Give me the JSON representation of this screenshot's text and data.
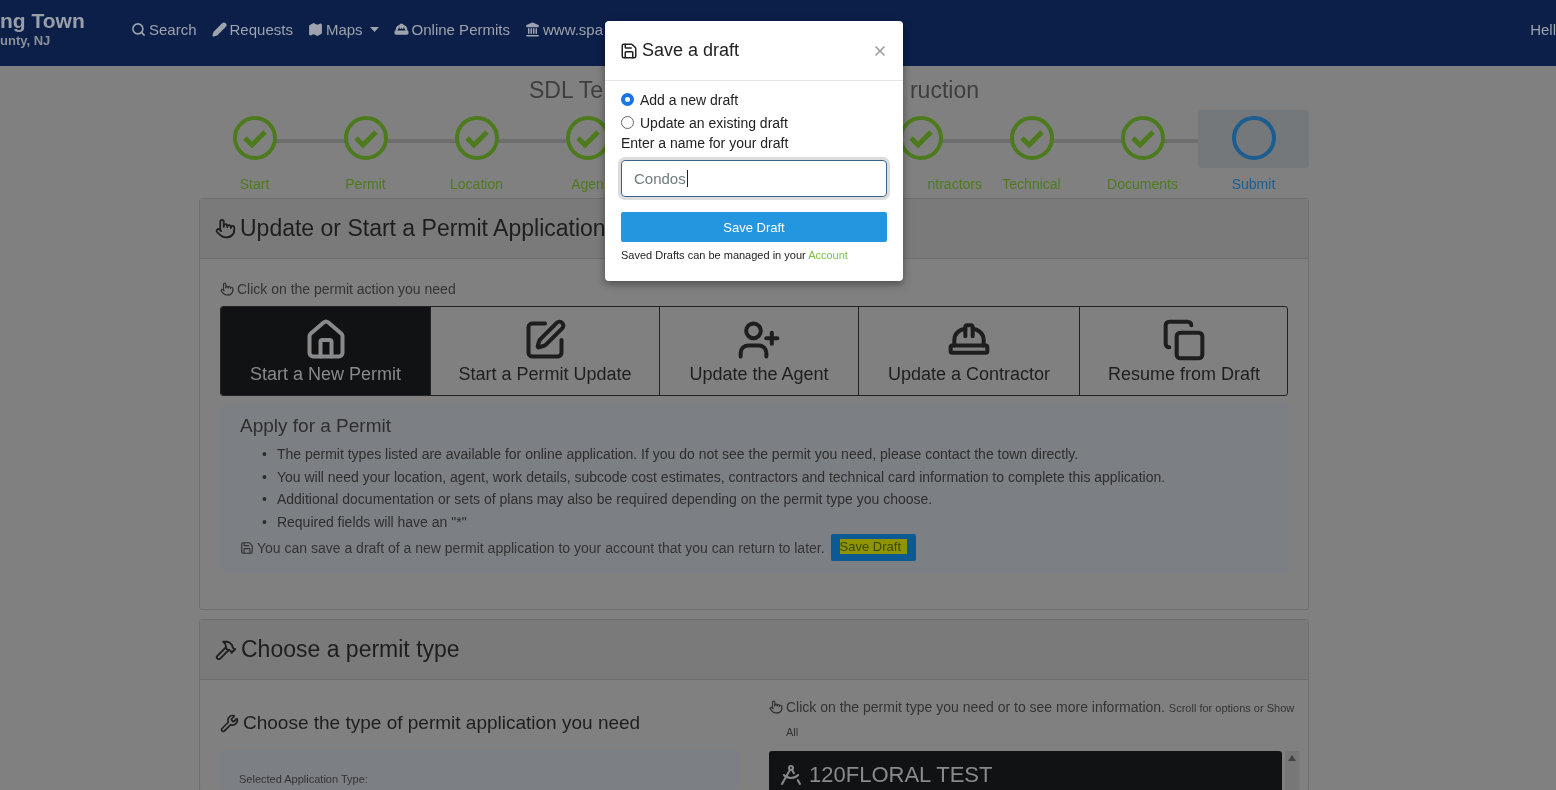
{
  "navbar": {
    "brand_title": "ng Town",
    "brand_subtitle": "unty, NJ",
    "links": [
      {
        "label": "Search",
        "kind": "search",
        "dropdown": false
      },
      {
        "label": "Requests",
        "kind": "pencil",
        "dropdown": false
      },
      {
        "label": "Maps",
        "kind": "map",
        "dropdown": true
      },
      {
        "label": "Online Permits",
        "kind": "hardhat",
        "dropdown": false
      },
      {
        "label": "www.spa",
        "kind": "landmark",
        "dropdown": false
      }
    ],
    "greeting": "Hell"
  },
  "page_title_parts": [
    "SDL Te",
    "ruction"
  ],
  "steps_before_dialog": [
    {
      "label": "Start",
      "done": true,
      "selected": false
    },
    {
      "label": "Permit",
      "done": true,
      "selected": false
    },
    {
      "label": "Location",
      "done": true,
      "selected": false
    },
    {
      "label": "Agen",
      "done": true,
      "selected": false
    }
  ],
  "steps_after_dialog": [
    {
      "label": "ntractors",
      "done": true,
      "selected": false
    },
    {
      "label": "Technical",
      "done": true,
      "selected": false
    },
    {
      "label": "Documents",
      "done": true,
      "selected": false
    },
    {
      "label": "Submit",
      "done": false,
      "selected": true
    }
  ],
  "permit_panel": {
    "title": "Update or Start a Permit Application",
    "hint": "Click on the permit action you need",
    "actions": [
      {
        "label": "Start a New Permit",
        "kind": "house",
        "selected": true
      },
      {
        "label": "Start a Permit Update",
        "kind": "edit",
        "selected": false
      },
      {
        "label": "Update the Agent",
        "kind": "user-plus",
        "selected": false
      },
      {
        "label": "Update a Contractor",
        "kind": "hardhat",
        "selected": false
      },
      {
        "label": "Resume from Draft",
        "kind": "copy",
        "selected": false
      }
    ],
    "info": {
      "title": "Apply for a Permit",
      "marker": "•",
      "bullets": [
        "The permit types listed are available for online application. If you do not see the permit you need, please contact the town directly.",
        "You will need your location, agent, work details, subcode cost estimates, contractors and technical card information to complete this application.",
        "Additional documentation or sets of plans may also be required depending on the permit type you choose.",
        "Required fields will have an \"*\""
      ],
      "save_note": "You can save a draft of a new permit application to your account that you can return to later.",
      "save_button": "Save Draft"
    }
  },
  "type_panel": {
    "title": "Choose a permit type",
    "left_heading": "Choose the type of permit application you need",
    "selected_label": "Selected Application Type:",
    "hint": "Click on the permit type you need or to see more information.",
    "hint_small": "Scroll for options or Show All",
    "list_items": [
      {
        "label": "120FLORAL TEST"
      }
    ]
  },
  "dialog": {
    "title": "Save a draft",
    "options": [
      {
        "label": "Add a new draft",
        "selected": true
      },
      {
        "label": "Update an existing draft",
        "selected": false
      }
    ],
    "name_label": "Enter a name for your draft",
    "name_value": "Condos",
    "save_button": "Save Draft",
    "footer_text": "Saved Drafts can be managed in your",
    "footer_link": "Account"
  }
}
